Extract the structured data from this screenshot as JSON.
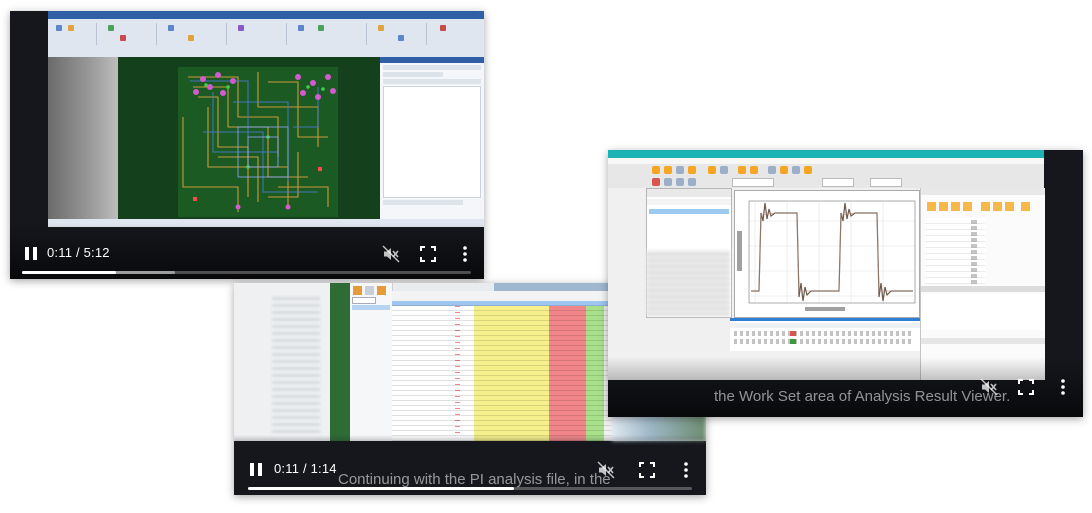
{
  "players": [
    {
      "id": "pcb-layout",
      "time": "0:11 / 5:12",
      "progress_fraction": 0.21,
      "caption": ""
    },
    {
      "id": "pi-analysis",
      "time": "0:11 / 1:14",
      "progress_fraction": 0.6,
      "caption": "Continuing with the PI analysis file, in the"
    },
    {
      "id": "work-set",
      "time": "",
      "progress_fraction": 0.55,
      "caption": "the Work Set area of Analysis Result Viewer."
    }
  ],
  "icons": [
    "pause-icon",
    "volume-muted-icon",
    "fullscreen-icon",
    "more-options-icon"
  ],
  "colors": {
    "player_bg": "#15171c",
    "progress_fill": "#ffffff",
    "pcb_board": "#14401c",
    "ribbon_blue": "#2f5fa7",
    "scope_titlebar": "#1bb3b3",
    "waveform": "#6b5b4e",
    "table_yellow": "#f5f08c",
    "table_red": "#f0868a",
    "table_green": "#a9e08a",
    "table_blue": "#9fc6f0"
  }
}
